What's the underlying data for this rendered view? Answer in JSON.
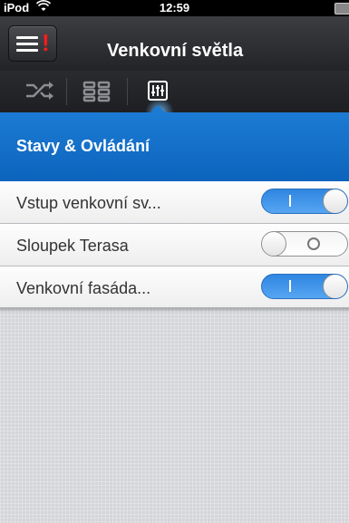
{
  "status_bar": {
    "carrier": "iPod",
    "time": "12:59"
  },
  "header": {
    "title": "Venkovní světla",
    "alert_mark": "!"
  },
  "toolbar": {
    "icons": [
      "scenes-icon",
      "grid-icon",
      "sliders-icon"
    ],
    "active_index": 2
  },
  "section": {
    "title": "Stavy & Ovládání"
  },
  "items": [
    {
      "label": "Vstup venkovní sv...",
      "state": "on"
    },
    {
      "label": "Sloupek Terasa",
      "state": "off"
    },
    {
      "label": "Venkovní fasáda...",
      "state": "on"
    }
  ],
  "colors": {
    "accent": "#1c7bd4",
    "toggle_on": "#3f95e9",
    "alert": "#ff1a1a"
  }
}
